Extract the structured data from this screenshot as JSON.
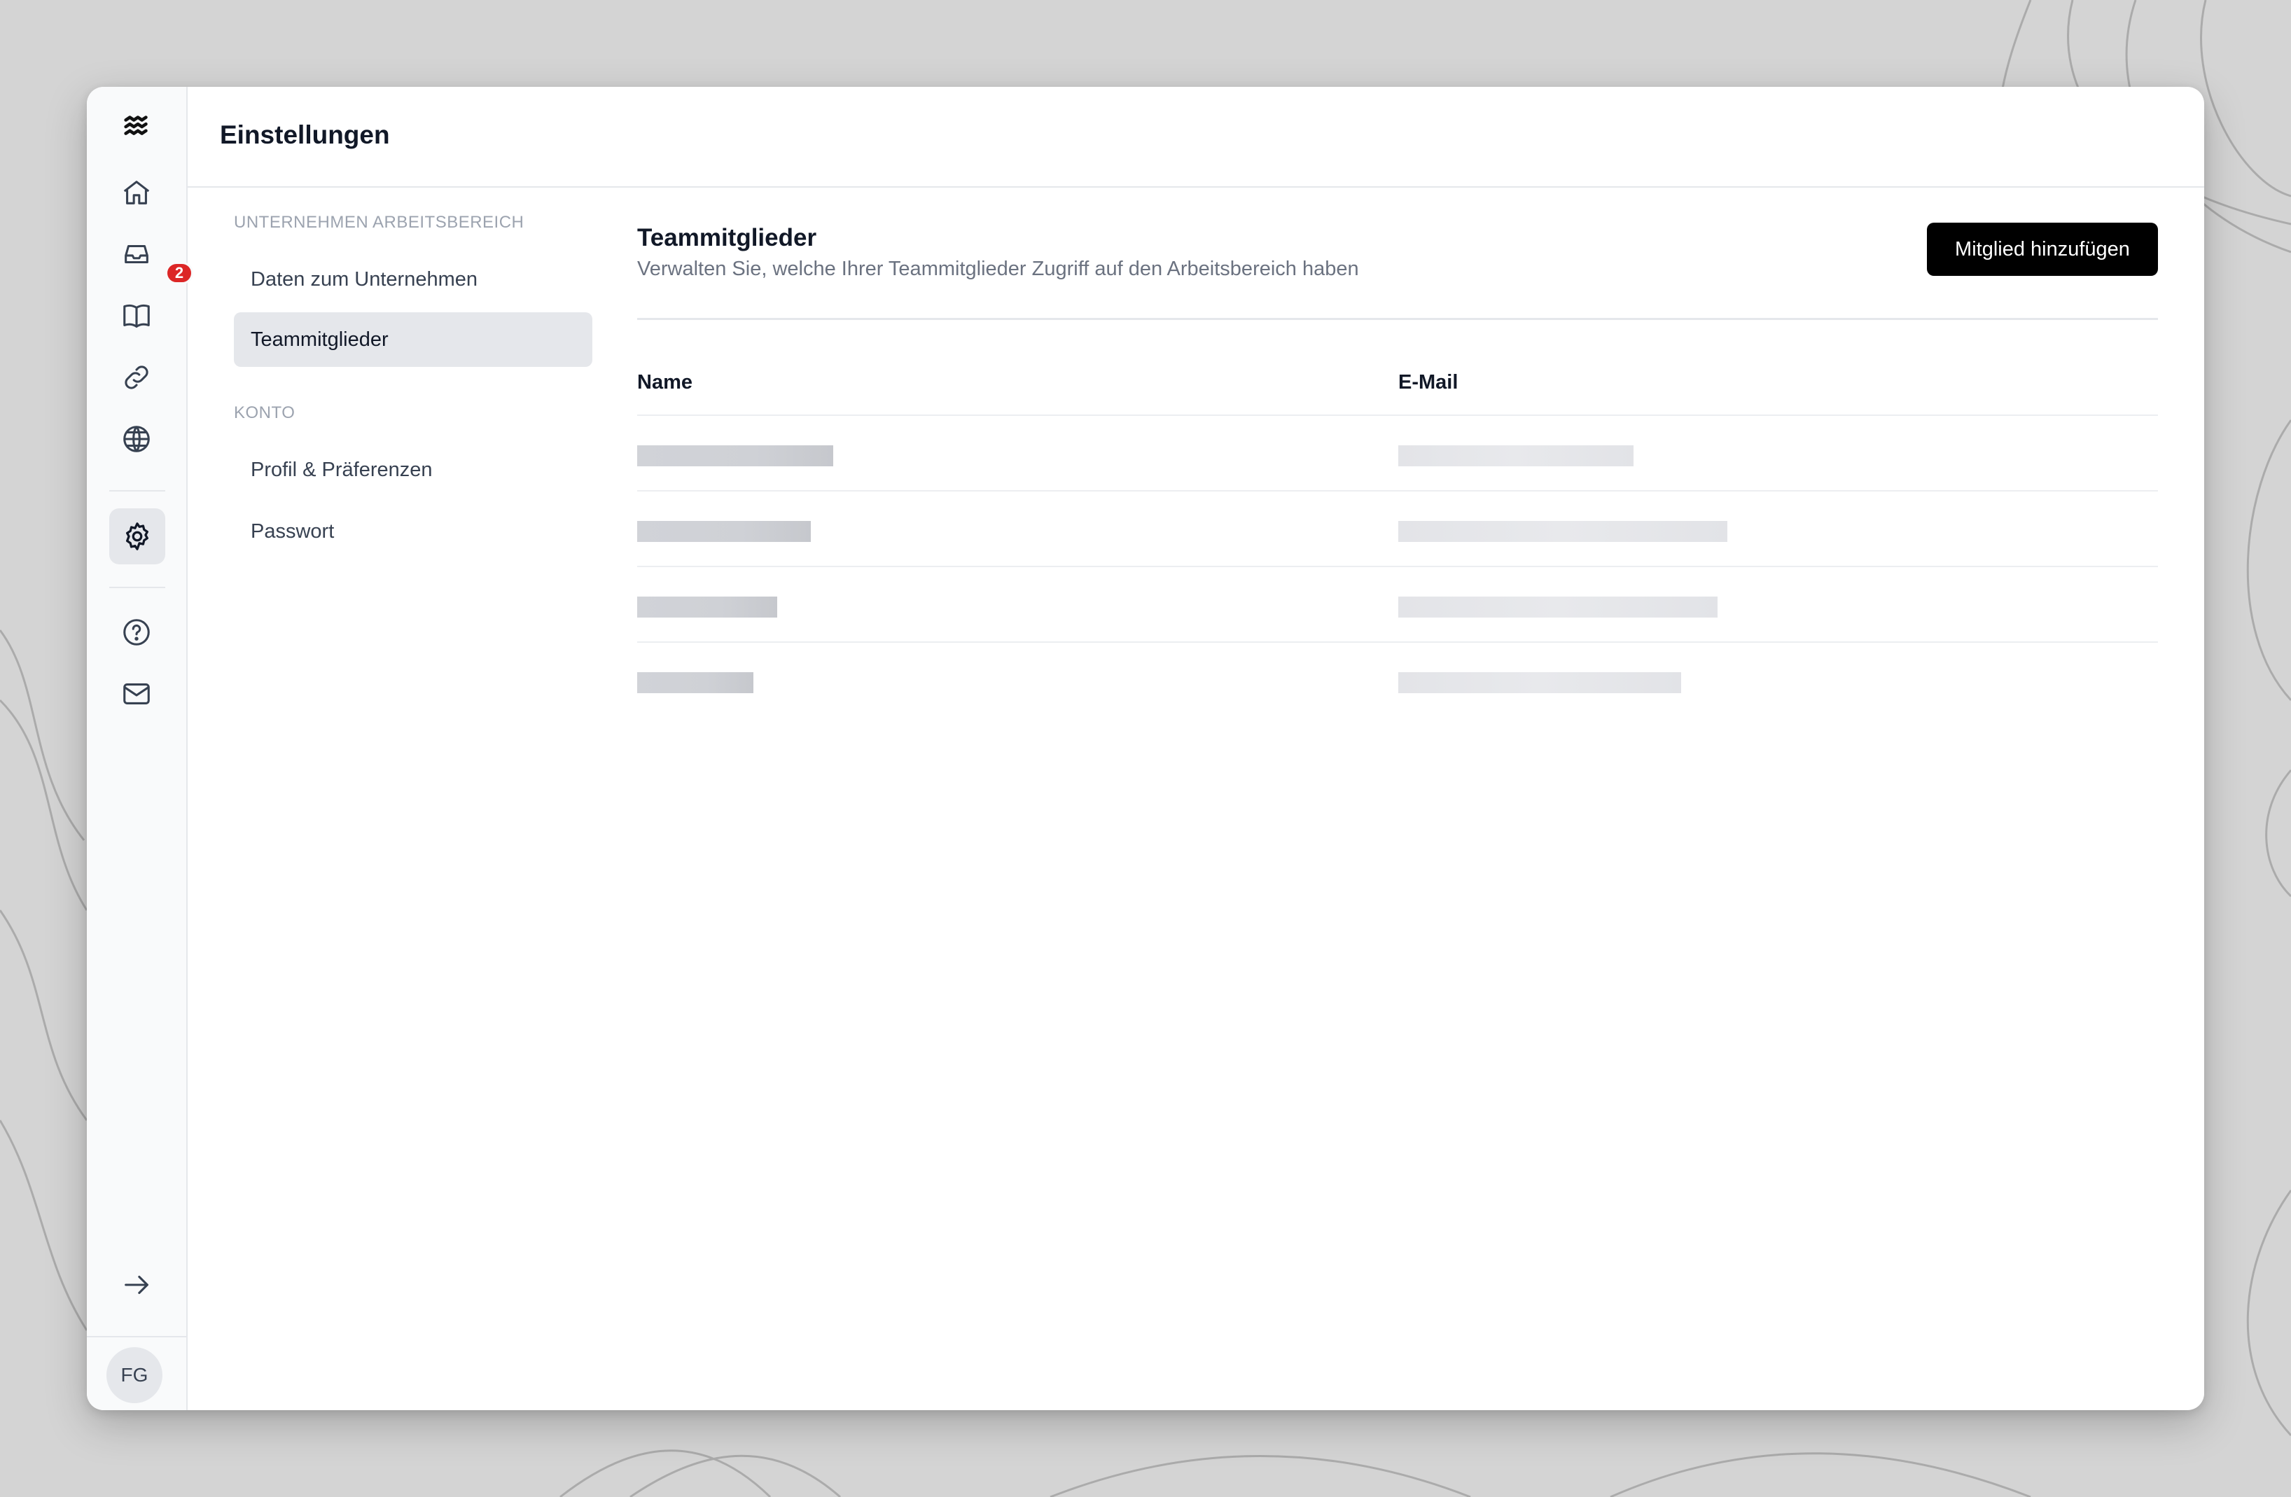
{
  "header": {
    "title": "Einstellungen"
  },
  "rail": {
    "icons": [
      "logo-waves-icon",
      "home-icon",
      "inbox-icon",
      "book-icon",
      "link-icon",
      "globe-icon",
      "gear-icon",
      "help-icon",
      "mail-icon",
      "arrow-right-icon"
    ],
    "inbox_badge": "2",
    "avatar_initials": "FG"
  },
  "nav": {
    "section_workspace": "UNTERNEHMEN ARBEITSBEREICH",
    "items_workspace": [
      "Daten zum Unternehmen",
      "Teammitglieder"
    ],
    "section_account": "KONTO",
    "items_account": [
      "Profil & Präferenzen",
      "Passwort"
    ],
    "active": "Teammitglieder"
  },
  "main": {
    "title": "Teammitglieder",
    "subtitle": "Verwalten Sie, welche Ihrer Teammitglieder Zugriff auf den Arbeitsbereich haben",
    "add_button": "Mitglied hinzufügen",
    "columns": [
      "Name",
      "E-Mail"
    ],
    "rows_redacted": 4
  },
  "colors": {
    "accent": "#000000",
    "badge": "#dc2626",
    "active_nav": "#e5e7eb"
  }
}
